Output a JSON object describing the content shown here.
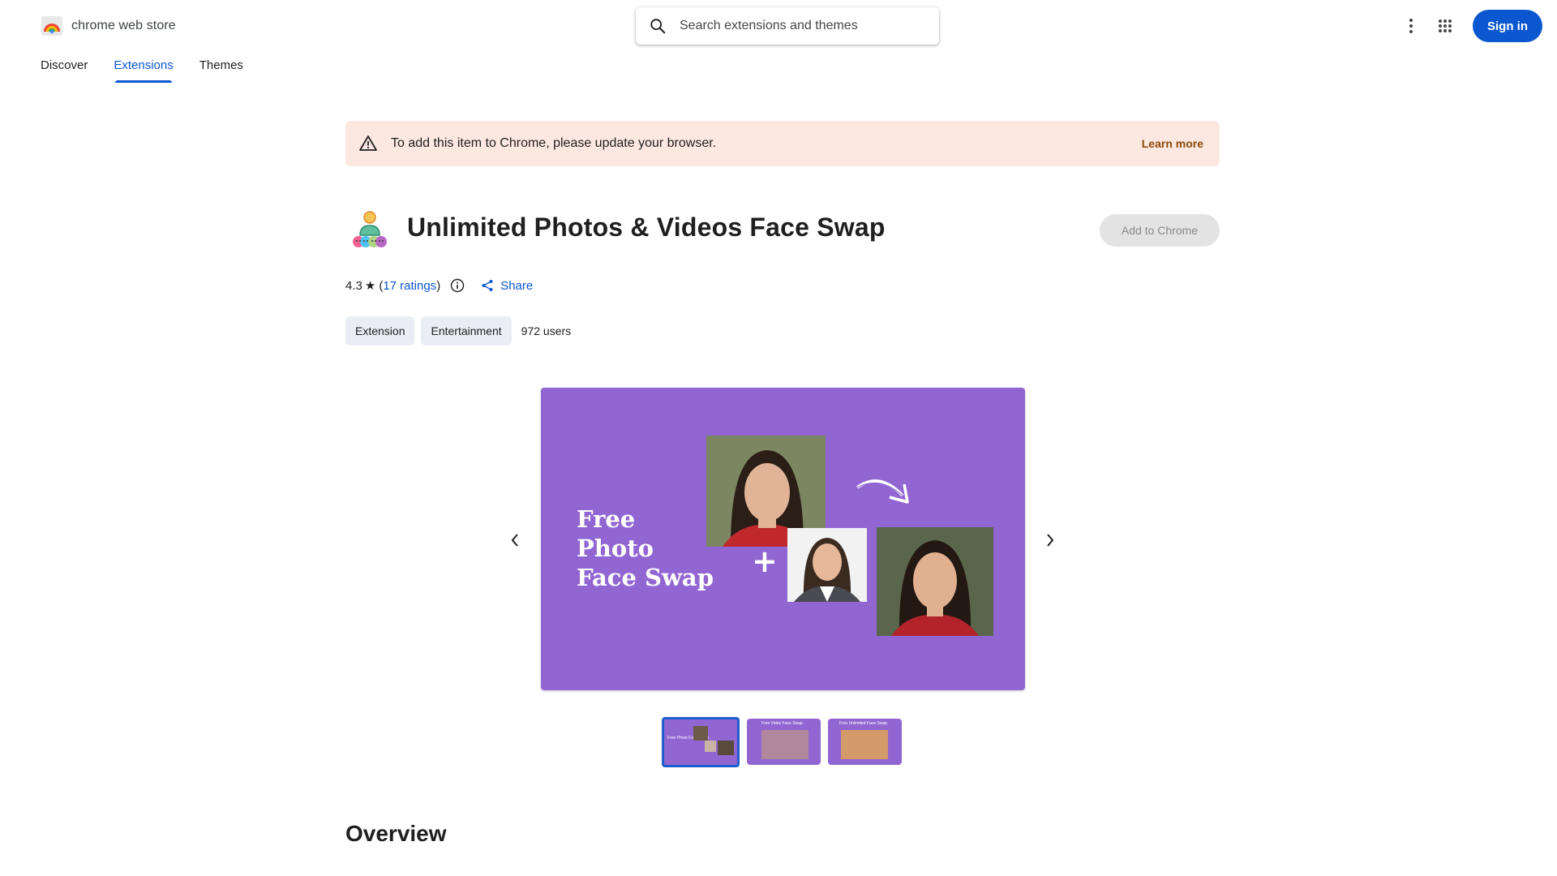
{
  "header": {
    "store_name": "chrome web store",
    "search_placeholder": "Search extensions and themes",
    "signin_label": "Sign in"
  },
  "nav": {
    "tabs": [
      {
        "label": "Discover",
        "active": false
      },
      {
        "label": "Extensions",
        "active": true
      },
      {
        "label": "Themes",
        "active": false
      }
    ]
  },
  "banner": {
    "text": "To add this item to Chrome, please update your browser.",
    "link": "Learn more"
  },
  "item": {
    "title": "Unlimited Photos & Videos Face Swap",
    "add_button": "Add to Chrome",
    "rating": "4.3",
    "ratings_count_label": "17 ratings",
    "share_label": "Share",
    "chips": [
      "Extension",
      "Entertainment"
    ],
    "users": "972 users"
  },
  "carousel": {
    "slide_text": [
      "Free",
      "Photo",
      "Face Swap"
    ],
    "thumbnail_captions": [
      "Free Photo Face Swap",
      "Free Video Face Swap",
      "Free Unlimited Face Swap"
    ],
    "active_index": 0
  },
  "overview_heading": "Overview",
  "colors": {
    "accent": "#0b57d0",
    "banner_bg": "#fce8e0",
    "slide_bg": "#9266d2"
  }
}
